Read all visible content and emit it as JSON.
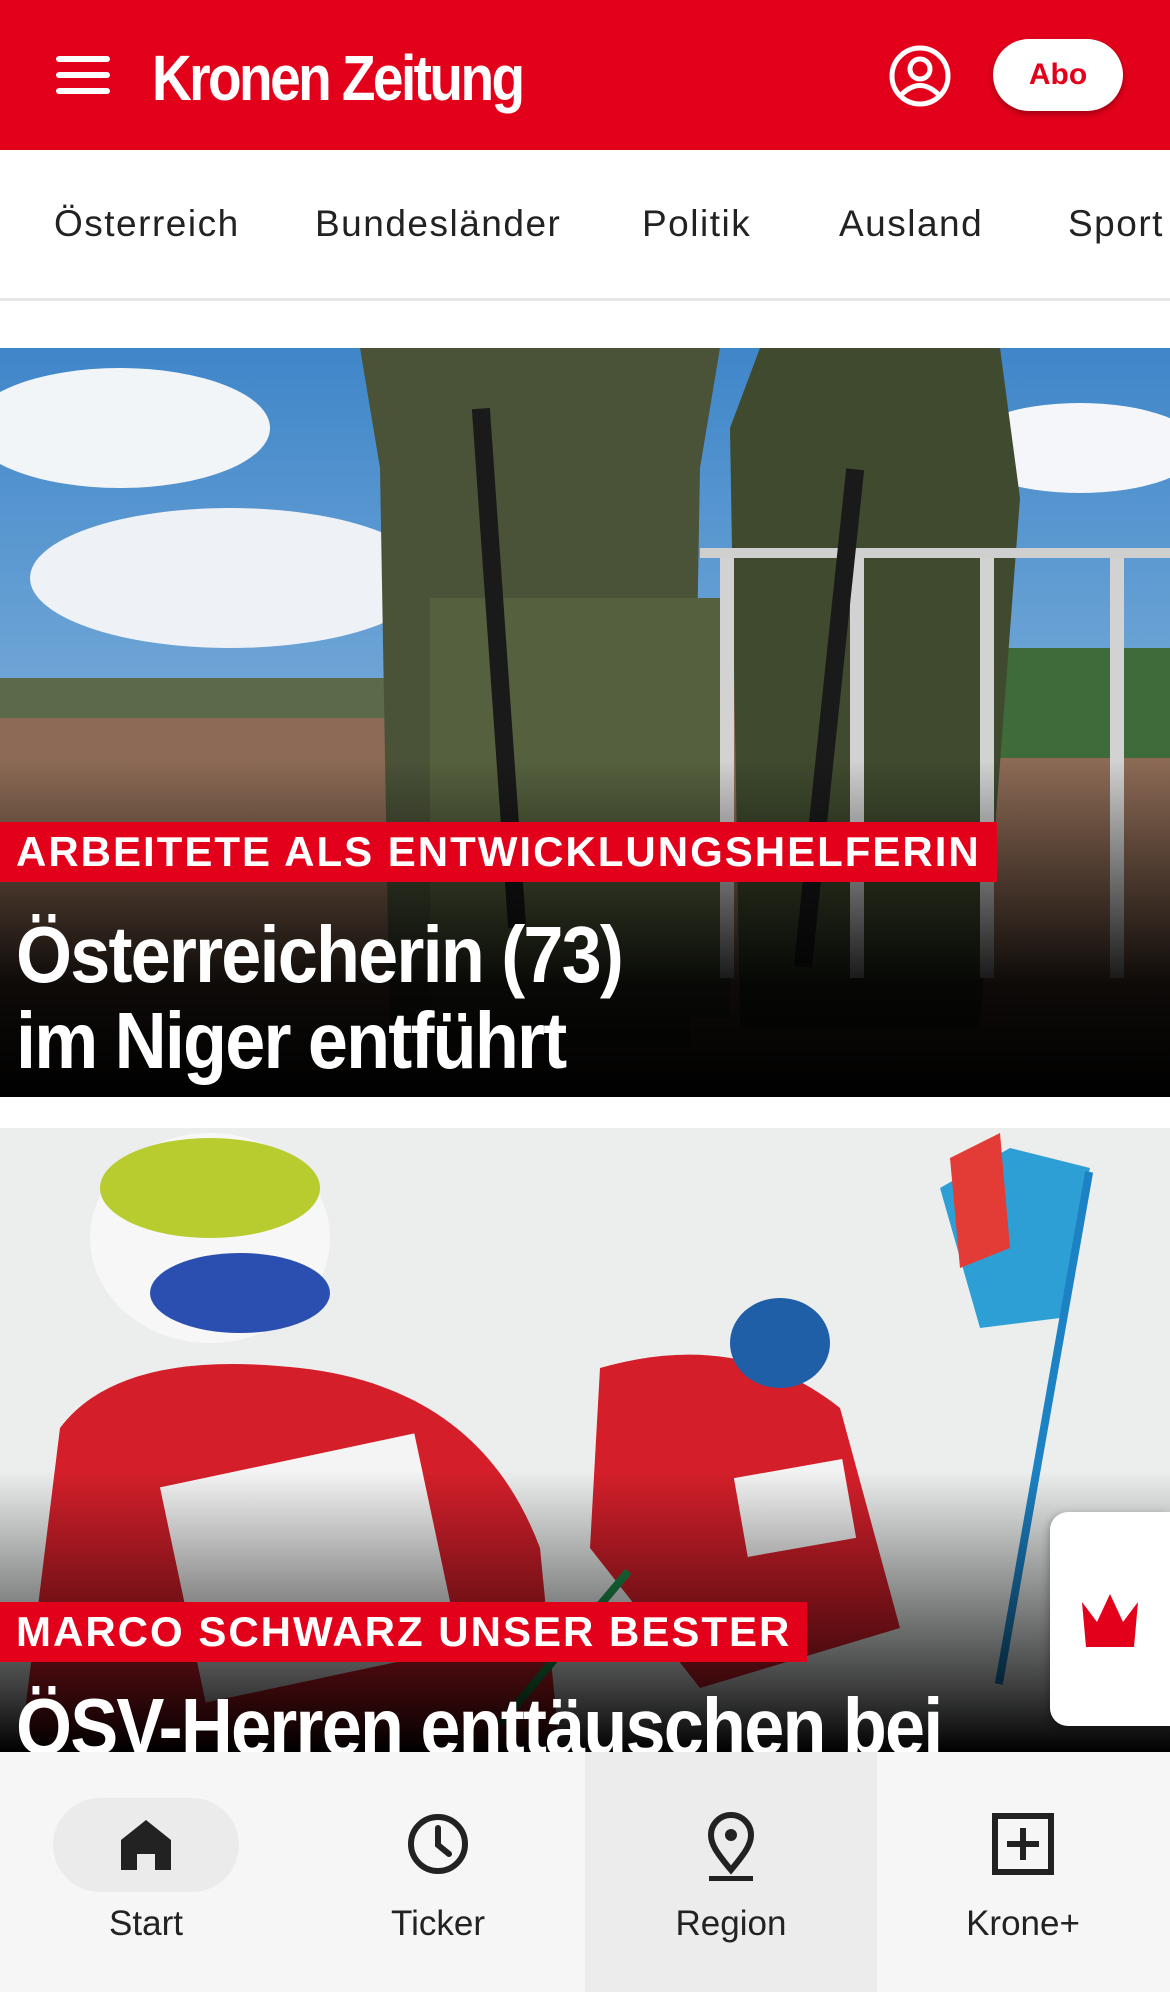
{
  "header": {
    "logo": "Kronen Zeitung",
    "abo_label": "Abo",
    "brand_color": "#e2001a"
  },
  "nav": {
    "items": [
      "Österreich",
      "Bundesländer",
      "Politik",
      "Ausland",
      "Sport"
    ]
  },
  "articles": [
    {
      "kicker": "ARBEITETE ALS ENTWICKLUNGSHELFERIN",
      "headline_line1": "Österreicherin (73)",
      "headline_line2": "im Niger entführt"
    },
    {
      "kicker": "MARCO SCHWARZ UNSER BESTER",
      "headline_line1": "ÖSV-Herren enttäuschen bei"
    }
  ],
  "tabbar": {
    "tabs": [
      {
        "label": "Start",
        "icon": "home-icon",
        "active": true
      },
      {
        "label": "Ticker",
        "icon": "clock-icon"
      },
      {
        "label": "Region",
        "icon": "location-pin-icon"
      },
      {
        "label": "Krone+",
        "icon": "plus-box-icon"
      }
    ]
  }
}
